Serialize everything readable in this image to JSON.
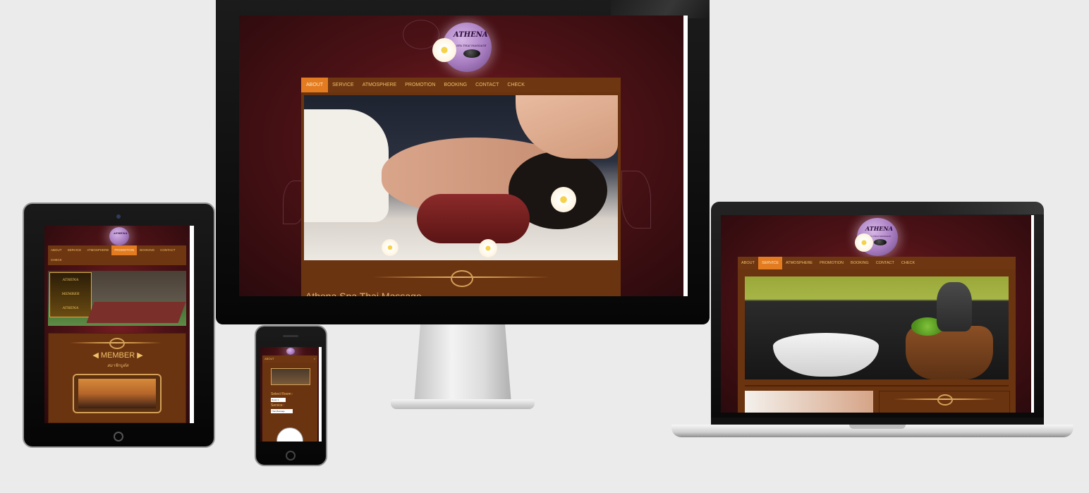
{
  "site": {
    "logo_title": "ATHENA",
    "logo_subtitle": "SPA THAI MASSAGE",
    "nav": [
      "ABOUT",
      "SERVICE",
      "ATMOSPHERE",
      "PROMOTION",
      "BOOKING",
      "CONTACT",
      "CHECK"
    ]
  },
  "desktop": {
    "active_nav": "ABOUT",
    "heading": "Athena Spa Thai Massage"
  },
  "laptop": {
    "active_nav": "SERVICE"
  },
  "tablet": {
    "active_nav": "PROMOTION",
    "member_title": "MEMBER",
    "member_subtitle": "สมาชิกบูตัส",
    "banner_lines": [
      "ATHENA",
      "MEMBER",
      "ATHENA"
    ]
  },
  "phone": {
    "menu_label": "ABOUT",
    "close": "×",
    "select_room_label": "Select Room :",
    "room_option": "Room 1",
    "service_label": "Service :",
    "service_option": "Thai Massage"
  },
  "colors": {
    "accent": "#e37b20",
    "nav_text": "#f0c06a",
    "panel": "#6b3410",
    "background": "#4d1216"
  }
}
